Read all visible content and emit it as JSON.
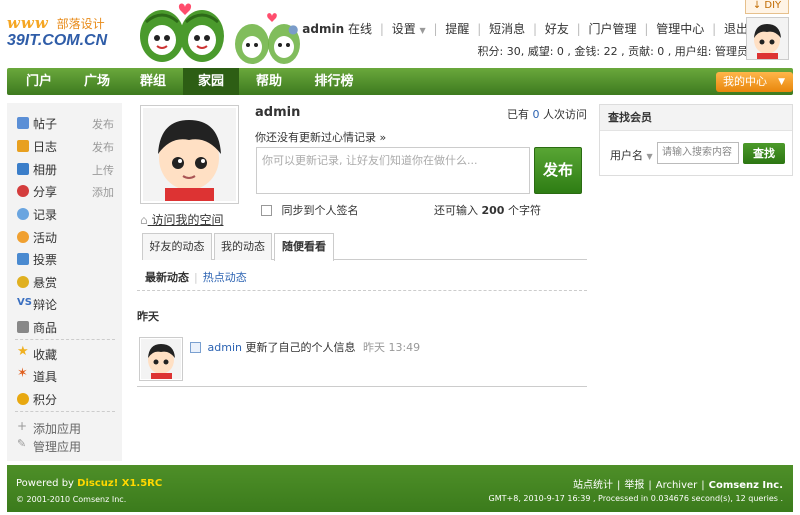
{
  "header": {
    "logo_www": "www",
    "logo_name": "部落设计",
    "logo_domain": "39IT.COM.CN",
    "diy_label": "DIY",
    "topnav": {
      "username": "admin",
      "online": "在线",
      "settings": "设置",
      "remind": "提醒",
      "sms": "短消息",
      "friends": "好友",
      "portal_manage": "门户管理",
      "admin_center": "管理中心",
      "logout": "退出"
    },
    "credits": "积分: 30, 威望: 0 , 金钱: 22 , 贡献: 0 , 用户组: 管理员"
  },
  "nav": {
    "items": [
      {
        "label": "门户"
      },
      {
        "label": "广场"
      },
      {
        "label": "群组"
      },
      {
        "label": "家园"
      },
      {
        "label": "帮助"
      },
      {
        "label": "排行榜"
      }
    ],
    "active": "家园",
    "my_center": "我的中心"
  },
  "sidebar": {
    "items": [
      {
        "label": "帖子",
        "action": "发布",
        "icon": "posts-icon",
        "color": "#5b8fd6"
      },
      {
        "label": "日志",
        "action": "发布",
        "icon": "blog-icon",
        "color": "#e8a020"
      },
      {
        "label": "相册",
        "action": "上传",
        "icon": "album-icon",
        "color": "#3b7ec9"
      },
      {
        "label": "分享",
        "action": "添加",
        "icon": "share-icon",
        "color": "#d43d3d"
      },
      {
        "label": "记录",
        "action": "",
        "icon": "doing-icon",
        "color": "#6aa5e0"
      },
      {
        "label": "活动",
        "action": "",
        "icon": "activity-icon",
        "color": "#f0a030"
      },
      {
        "label": "投票",
        "action": "",
        "icon": "poll-icon",
        "color": "#4a8ad0"
      },
      {
        "label": "悬赏",
        "action": "",
        "icon": "reward-icon",
        "color": "#e0b020"
      },
      {
        "label": "辩论",
        "action": "",
        "icon": "debate-icon",
        "color": "#3a6fc0"
      },
      {
        "label": "商品",
        "action": "",
        "icon": "goods-icon",
        "color": "#888888"
      },
      {
        "label": "收藏",
        "action": "",
        "icon": "favorite-icon",
        "color": "#f0b020"
      },
      {
        "label": "道具",
        "action": "",
        "icon": "magic-icon",
        "color": "#e06020"
      },
      {
        "label": "积分",
        "action": "",
        "icon": "credit-icon",
        "color": "#e8a810"
      }
    ],
    "add_app": "添加应用",
    "manage_app": "管理应用"
  },
  "main": {
    "username": "admin",
    "visits_prefix": "已有",
    "visits_count": "0",
    "visits_suffix": "人次访问",
    "mood_label": "你还没有更新过心情记录 »",
    "mood_placeholder": "你可以更新记录, 让好友们知道你在做什么...",
    "publish": "发布",
    "sync_label": "同步到个人签名",
    "remain_prefix": "还可输入",
    "remain_count": "200",
    "remain_suffix": "个字符",
    "visit_space": "访问我的空间",
    "tabs": [
      {
        "label": "好友的动态"
      },
      {
        "label": "我的动态"
      },
      {
        "label": "随便看看"
      }
    ],
    "subtabs": {
      "latest": "最新动态",
      "hot": "热点动态"
    },
    "day_label": "昨天",
    "feed": {
      "who": "admin",
      "text": "更新了自己的个人信息",
      "time": "昨天 13:49"
    }
  },
  "search": {
    "title": "查找会员",
    "field": "用户名",
    "placeholder": "请输入搜索内容",
    "button": "查找"
  },
  "footer": {
    "powered_prefix": "Powered by ",
    "powered_brand": "Discuz! X1.5RC",
    "copyright": "© 2001-2010 Comsenz Inc.",
    "links": [
      "站点统计",
      "举报",
      "Archiver",
      "Comsenz Inc."
    ],
    "stats": "GMT+8, 2010-9-17 16:39 , Processed in 0.034676 second(s), 12 queries ."
  },
  "colors": {
    "nav_green": "#3d7a1f",
    "accent_orange": "#e8860c",
    "link_blue": "#2d64b3"
  }
}
